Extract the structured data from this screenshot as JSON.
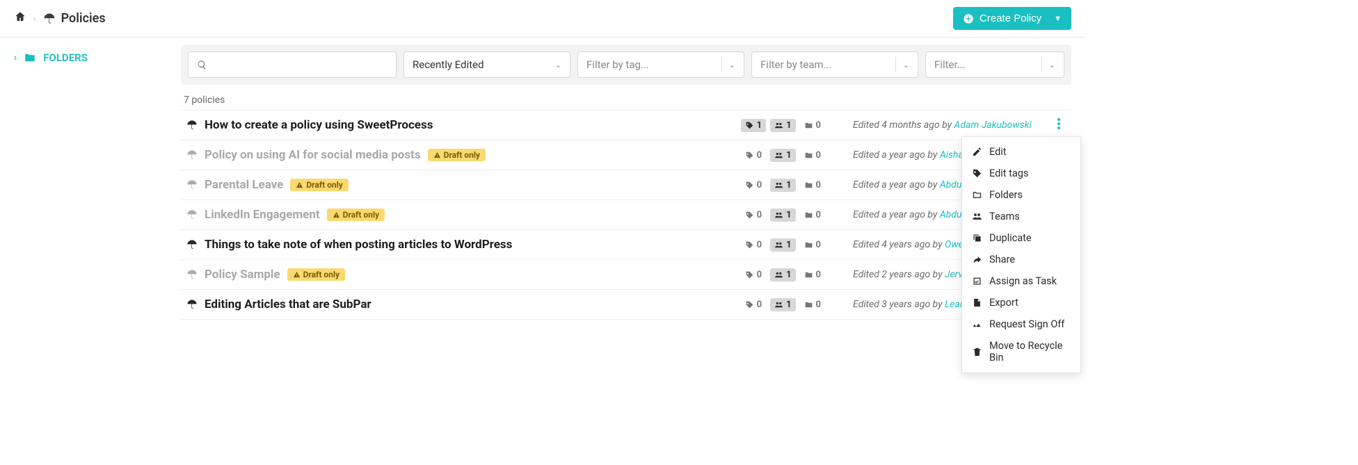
{
  "breadcrumb": {
    "title": "Policies"
  },
  "header": {
    "create_label": "Create Policy"
  },
  "sidebar": {
    "folders_label": "FOLDERS"
  },
  "filters": {
    "sort_label": "Recently Edited",
    "tag_placeholder": "Filter by tag...",
    "team_placeholder": "Filter by team...",
    "generic_placeholder": "Filter..."
  },
  "count_label": "7 policies",
  "draft_badge_label": "Draft only",
  "edited_prefix": "Edited ",
  "edited_by": " by ",
  "policies": [
    {
      "title": "How to create a policy using SweetProcess",
      "draft": false,
      "tags_count": 1,
      "tags_active": true,
      "teams_count": 1,
      "teams_active": true,
      "folders_count": 0,
      "edited_ago": "4 months ago",
      "author": "Adam Jakubowski",
      "menu_open": true
    },
    {
      "title": "Policy on using AI for social media posts",
      "draft": true,
      "tags_count": 0,
      "tags_active": false,
      "teams_count": 1,
      "teams_active": true,
      "folders_count": 0,
      "edited_ago": "a year ago",
      "author": "Aisha Sulai"
    },
    {
      "title": "Parental Leave",
      "draft": true,
      "tags_count": 0,
      "tags_active": false,
      "teams_count": 1,
      "teams_active": true,
      "folders_count": 0,
      "edited_ago": "a year ago",
      "author": "AbdulGaniy"
    },
    {
      "title": "LinkedIn Engagement",
      "draft": true,
      "tags_count": 0,
      "tags_active": false,
      "teams_count": 1,
      "teams_active": true,
      "folders_count": 0,
      "edited_ago": "a year ago",
      "author": "AbdulGaniy"
    },
    {
      "title": "Things to take note of when posting articles to WordPress",
      "draft": false,
      "tags_count": 0,
      "tags_active": false,
      "teams_count": 1,
      "teams_active": true,
      "folders_count": 0,
      "edited_ago": "4 years ago",
      "author": "Owen McG"
    },
    {
      "title": "Policy Sample",
      "draft": true,
      "tags_count": 0,
      "tags_active": false,
      "teams_count": 1,
      "teams_active": true,
      "folders_count": 0,
      "edited_ago": "2 years ago",
      "author": "Jervis Whit"
    },
    {
      "title": "Editing Articles that are SubPar",
      "draft": false,
      "tags_count": 0,
      "tags_active": false,
      "teams_count": 1,
      "teams_active": true,
      "folders_count": 0,
      "edited_ago": "3 years ago",
      "author": "Leann Post"
    }
  ],
  "context_menu": [
    {
      "icon": "edit",
      "label": "Edit"
    },
    {
      "icon": "tag",
      "label": "Edit tags"
    },
    {
      "icon": "folder",
      "label": "Folders"
    },
    {
      "icon": "teams",
      "label": "Teams"
    },
    {
      "icon": "copy",
      "label": "Duplicate"
    },
    {
      "icon": "share",
      "label": "Share"
    },
    {
      "icon": "task",
      "label": "Assign as Task"
    },
    {
      "icon": "export",
      "label": "Export"
    },
    {
      "icon": "signoff",
      "label": "Request Sign Off"
    },
    {
      "icon": "trash",
      "label": "Move to Recycle Bin"
    }
  ]
}
